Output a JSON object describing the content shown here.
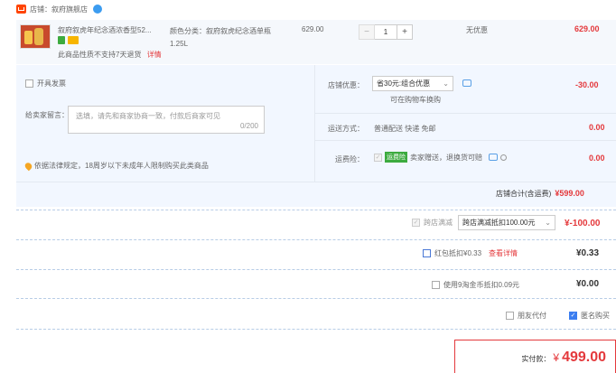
{
  "store": {
    "label": "店铺：叙府旗舰店",
    "icon_color": "#ff4400"
  },
  "item": {
    "title": "叙府叙虎年纪念酒浓香型52...",
    "spec": "颜色分类：叙府叙虎纪念酒单瓶1.25L",
    "unit_price": "629.00",
    "quantity": "1",
    "minus": "−",
    "plus": "+",
    "discount": "无优惠",
    "subtotal": "629.00",
    "no_return_note": "此商品性质不支持7天退货",
    "detail_link": "详情"
  },
  "invoice": {
    "label": "开具发票"
  },
  "message": {
    "label": "给卖家留言：",
    "placeholder_line1": "选填，请先和商家协商一致，付款后商家可见",
    "counter": "0/200"
  },
  "legal_note": "依据法律规定，18周岁以下未成年人限制购买此类商品",
  "store_discount": {
    "label": "店铺优惠：",
    "value": "省30元:组合优惠",
    "sub": "可在购物车换购",
    "amount": "-30.00"
  },
  "shipping": {
    "label": "运送方式：",
    "value": "普通配送 快递 免邮",
    "amount": "0.00"
  },
  "insurance": {
    "label": "运费险：",
    "badge": "运费险",
    "text": "卖家赠送，退换货可赔",
    "amount": "0.00"
  },
  "store_total": {
    "label": "店铺合计(含运费)",
    "amount": "¥599.00"
  },
  "cross_store": {
    "label": "跨店满减",
    "value": "跨店满减抵扣100.00元",
    "amount": "¥-100.00"
  },
  "red_packet": {
    "label": "红包抵扣¥0.33",
    "link": "查看详情",
    "amount": "¥0.33"
  },
  "coins": {
    "label": "使用9淘金币抵扣0.09元",
    "amount": "¥0.00"
  },
  "options": {
    "friend_pay": "朋友代付",
    "anonymous": "匿名购买"
  },
  "payment": {
    "label": "实付款：",
    "currency": "¥",
    "amount": "499.00"
  },
  "colors": {
    "accent": "#e4393c",
    "panel_bg": "#f2f7ff",
    "checkbox_blue": "#3b7df0",
    "green_badge": "#3dab3f"
  }
}
